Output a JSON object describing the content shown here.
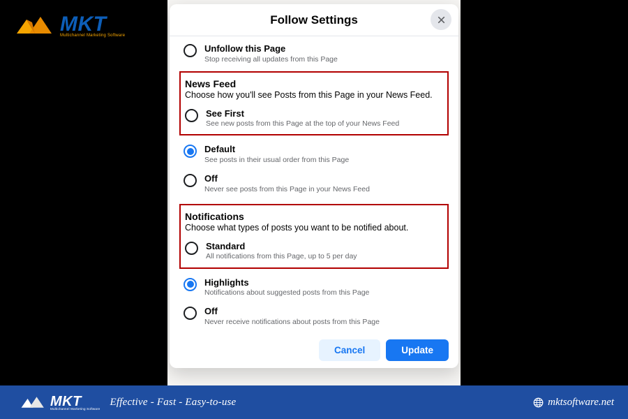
{
  "logo": {
    "brand": "MKT",
    "subtitle": "Multichannel Marketing Software"
  },
  "modal": {
    "title": "Follow Settings",
    "unfollow": {
      "label": "Unfollow this Page",
      "sub": "Stop receiving all updates from this Page"
    },
    "news_feed": {
      "title": "News Feed",
      "desc": "Choose how you'll see Posts from this Page in your News Feed.",
      "options": [
        {
          "label": "See First",
          "sub": "See new posts from this Page at the top of your News Feed",
          "selected": false
        },
        {
          "label": "Default",
          "sub": "See posts in their usual order from this Page",
          "selected": true
        },
        {
          "label": "Off",
          "sub": "Never see posts from this Page in your News Feed",
          "selected": false
        }
      ]
    },
    "notifications": {
      "title": "Notifications",
      "desc": "Choose what types of posts you want to be notified about.",
      "options": [
        {
          "label": "Standard",
          "sub": "All notifications from this Page, up to 5 per day",
          "selected": false
        },
        {
          "label": "Highlights",
          "sub": "Notifications about suggested posts from this Page",
          "selected": true
        },
        {
          "label": "Off",
          "sub": "Never receive notifications about posts from this Page",
          "selected": false
        }
      ]
    },
    "cancel": "Cancel",
    "update": "Update"
  },
  "footer": {
    "tagline": "Effective - Fast - Easy-to-use",
    "site": "mktsoftware.net"
  }
}
